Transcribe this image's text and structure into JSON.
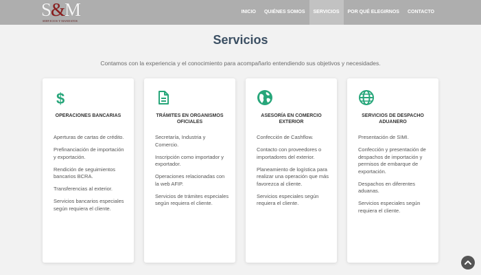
{
  "brand": {
    "logo_mark_s": "S",
    "logo_mark_amp": "&",
    "logo_mark_m": "M",
    "logo_sub": "SERVICIOS Y MANDATOS"
  },
  "nav": {
    "items": [
      {
        "label": "INICIO",
        "active": false
      },
      {
        "label": "QUIÉNES SOMOS",
        "active": false
      },
      {
        "label": "SERVICIOS",
        "active": true
      },
      {
        "label": "POR QUÉ ELEGIRNOS",
        "active": false
      },
      {
        "label": "CONTACTO",
        "active": false
      }
    ]
  },
  "section": {
    "title": "Servicios",
    "subtitle": "Contamos con la experiencia y el conocimiento para acompañarlo entendiendo sus objetivos y necesidades."
  },
  "cards": [
    {
      "icon": "dollar-sign-icon",
      "title": "OPERACIONES BANCARIAS",
      "items": [
        "Aperturas de cartas de crédito.",
        "Prefinanciación de importación y exportación.",
        "Rendición de seguimientos bancarios BCRA.",
        "Transferencias al exterior.",
        "Servicios bancarios especiales según requiera el cliente."
      ]
    },
    {
      "icon": "document-icon",
      "title": "TRÁMITES EN ORGANISMOS OFICIALES",
      "items": [
        "Secretaría, Industria y Comercio.",
        "Inscripción como importador y exportador.",
        "Operaciones relacionadas con la web AFIP.",
        "Servicios de trámites especiales según requiera el cliente."
      ]
    },
    {
      "icon": "globe-americas-icon",
      "title": "ASESORÍA EN COMERCIO EXTERIOR",
      "items": [
        "Confección de Cashflow.",
        "Contacto con proveedores o importadores del exterior.",
        "Planeamiento de logística para realizar una operación que más favorezca al cliente.",
        "Servicios especiales según requiera el cliente."
      ]
    },
    {
      "icon": "globe-grid-icon",
      "title": "SERVICIOS DE DESPACHO ADUANERO",
      "items": [
        "Presentación de SIMI.",
        "Confección y presentación de despachos de importación y permisos de embarque de exportación.",
        "Despachos en diferentes aduanas.",
        "Servicios especiales según requiera el cliente."
      ]
    }
  ],
  "colors": {
    "accent": "#27a67a",
    "title": "#3b4f63",
    "navbar": "#aeaeae",
    "background": "#f2f2f2"
  },
  "scroll_top_icon": "chevron-up-icon"
}
